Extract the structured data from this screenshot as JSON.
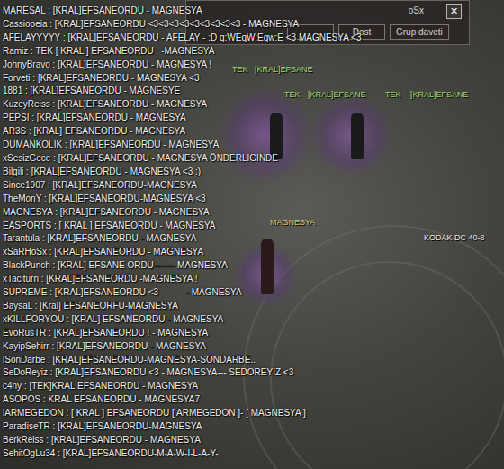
{
  "window": {
    "title": "oSx",
    "close": "✕"
  },
  "popup_buttons": [
    "Dost",
    "Grup daveti"
  ],
  "scene_labels": [
    {
      "text": "TEK",
      "color": "#9fd86a"
    },
    {
      "text": "[KRAL]EFSANE",
      "color": "#9fd86a"
    },
    {
      "text": "TEK",
      "color": "#9fd86a"
    },
    {
      "text": "[KRAL]EFSANE",
      "color": "#9fd86a"
    },
    {
      "text": "TEK",
      "color": "#9fd86a"
    },
    {
      "text": "[KRAL]EFSANE",
      "color": "#9fd86a"
    },
    {
      "text": "MAGNESYA",
      "color": "#d9c96a"
    },
    {
      "text": "KODAK DC 40-8",
      "color": "#e8e8e8"
    }
  ],
  "chat": [
    "MARESAL : [KRAL]EFSANEORDU - MAGNESYA",
    "Cassiopeia : [KRAL]EFSANEORDU <3<3<3<3<3<3<3<3<3 - MAGNESYA",
    "AFELAYYYYY : [KRAL]EFSANEORDU - AFELAY - :D q:WEqW:Eqw:E <3 MAGNESYA <3",
    "Ramiz : TEK [ KRAL ] EFSANEORDU   -MAGNESYA",
    "JohnyBravo : [KRAL]EFSANEORDU - MAGNESYA !",
    "Forveti : [KRAL]EFSANEORDU - MAGNESYA <3",
    "1881 : [KRAL]EFSANEORDU - MAGNESYE",
    "KuzeyReiss : [KRAL]EFSANEORDU - MAGNESYA",
    "PEPSI : [KRAL]EFSANEORDU - MAGNESYA",
    "AR3S : [KRAL] EFSANEORDU - MAGNESYA",
    "DUMANKOLIK : [KRAL]EFSANEORDU - MAGNESYA",
    "xSesizGece : [KRAL]EFSANEORDU - MAGNESYA ÖNDERLIGINDE",
    "Bilgili : [KRAL]EFSANEORDU - MAGNESYA <3 :)",
    "Since1907 : [KRAL]EFSANEORDU-MAGNESYA",
    "TheMonY : [KRAL]EFSANEORDU-MAGNESYA <3",
    "MAGNESYA : [KRAL]EFSANEORDU - MAGNESYA",
    "EASPORTS : [ KRAL ] EFSANEORDU - MAGNESYA",
    "Tarantula : [KRAL]EFSANEORDU - MAGNESYA",
    "xSaRHoSx : [KRAL]EFSANEORDU - MAGNESYA",
    "BlackPunch : [KRAL] EFSANE ORDU------- MAGNESYA",
    "xTaciturn : [KRAL]EFSANEORDU -MAGNESYA !",
    "SUPREME : [KRAL]EFSANEORDU <3           - MAGNESYA",
    "BaysaL : [Kral] EFSANEORFU-MAGNESYA",
    "xKILLFORYOU : [KRAL] EFSANEORDU - MAGNESYA",
    "EvoRusTR : [KRAL]EFSANEORDU ! - MAGNESYA",
    "KayipSehirr : [KRAL]EFSANEORDU - MAGNESYA",
    "lSonDarbe : [KRAL]EFSANEORDU-MAGNESYA-SONDARBE..",
    "SeDoReyiz : [KRAL]EFSANEORDU <3 - MAGNESYA--- SEDOREYIZ <3",
    "c4ny : [TEK]KRAL EFSANEORDU - MAGNESYA",
    "ASOPOS : KRAL EFSANEORDU - MAGNESYA7",
    "lARMEGEDON : [ KRAL ] EFSANEORDU [ ARMEGEDON ]- [ MAGNESYA ]",
    "ParadiseTR : [KRAL]EFSANEORDU-MAGNESYA",
    "BerkReiss : [KRAL]EFSANEORDU - MAGNESYA",
    "SehitOgLu34 : [KRAL]EFSANEORDU-M-A-W-I-L-A-Y-"
  ]
}
